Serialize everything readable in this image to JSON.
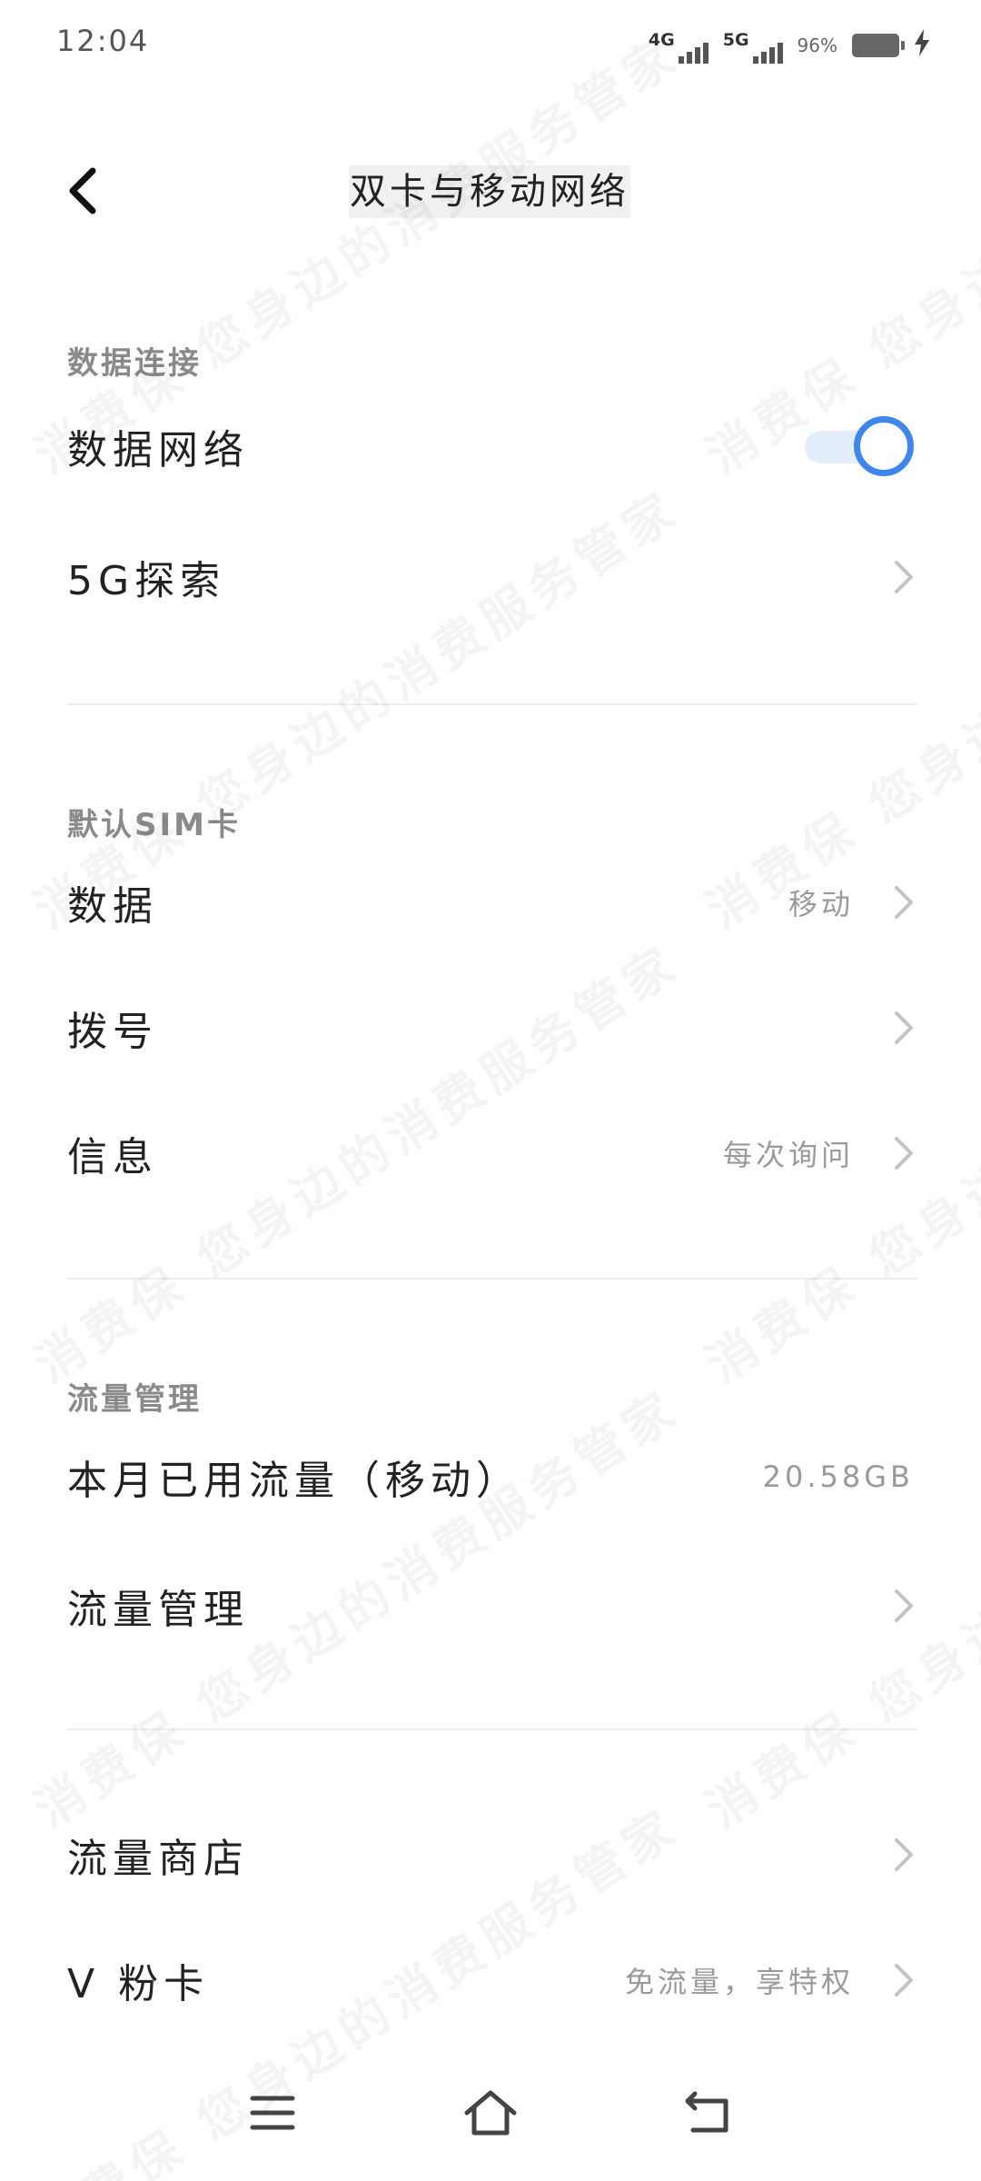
{
  "status_bar": {
    "time": "12:04",
    "sim1_network": "4G",
    "sim2_network": "5G",
    "battery_percent": "96%",
    "icons": [
      "signal-icon",
      "battery-icon",
      "charging-icon"
    ]
  },
  "header": {
    "title": "双卡与移动网络",
    "back_icon": "chevron-left-icon"
  },
  "sections": {
    "data_connection": {
      "label": "数据连接",
      "mobile_data": {
        "label": "数据网络",
        "enabled": true
      },
      "explore_5g": {
        "label": "5G探索"
      }
    },
    "default_sim": {
      "label": "默认SIM卡",
      "data": {
        "label": "数据",
        "value": "移动"
      },
      "calls": {
        "label": "拨号"
      },
      "messages": {
        "label": "信息",
        "value": "每次询问"
      }
    },
    "traffic": {
      "label": "流量管理",
      "month_usage": {
        "label": "本月已用流量（移动）",
        "value": "20.58GB"
      },
      "traffic_manage": {
        "label": "流量管理"
      }
    },
    "extra": {
      "store": {
        "label": "流量商店"
      },
      "vcard": {
        "label": "V 粉卡",
        "value": "免流量，享特权"
      }
    }
  },
  "watermark": {
    "text": "消费保 您身边的消费服务管家"
  },
  "nav_bar": {
    "icons": [
      "menu-icon",
      "home-icon",
      "back-icon"
    ]
  },
  "colors": {
    "accent": "#3d86f0",
    "toggle_track": "#e3edfb",
    "secondary_text": "#9a9a9a",
    "section_label": "#8a8a8a",
    "divider": "#eeeeee"
  }
}
